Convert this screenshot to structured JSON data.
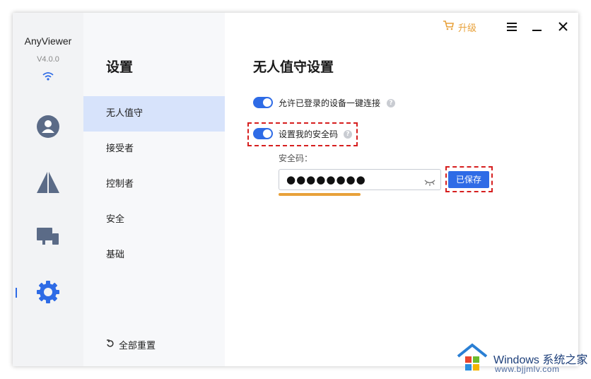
{
  "app": {
    "name": "AnyViewer",
    "version": "V4.0.0"
  },
  "rail": {
    "items": [
      {
        "icon": "user-icon"
      },
      {
        "icon": "connect-icon"
      },
      {
        "icon": "devices-icon"
      },
      {
        "icon": "gear-icon",
        "active": true
      }
    ]
  },
  "topbar": {
    "upgrade_label": "升级",
    "menu_icon": "menu-icon",
    "minimize_icon": "minimize-icon",
    "close_icon": "close-icon"
  },
  "nav": {
    "title": "设置",
    "items": [
      {
        "label": "无人值守",
        "active": true
      },
      {
        "label": "接受者"
      },
      {
        "label": "控制者"
      },
      {
        "label": "安全"
      },
      {
        "label": "基础"
      }
    ],
    "reset_label": "全部重置"
  },
  "main": {
    "title": "无人值守设置",
    "option1": {
      "label": "允许已登录的设备一键连接",
      "enabled": true
    },
    "option2": {
      "label": "设置我的安全码",
      "enabled": true
    },
    "code_label": "安全码：",
    "password_value": "●●●●●●●●",
    "saved_button": "已保存"
  },
  "help_glyph": "?",
  "watermark": {
    "title": "Windows 系统之家",
    "url": "www.bjjmlv.com"
  },
  "colors": {
    "accent": "#2e6be6",
    "highlight": "#d61f1f",
    "upgrade": "#e8a13a"
  }
}
